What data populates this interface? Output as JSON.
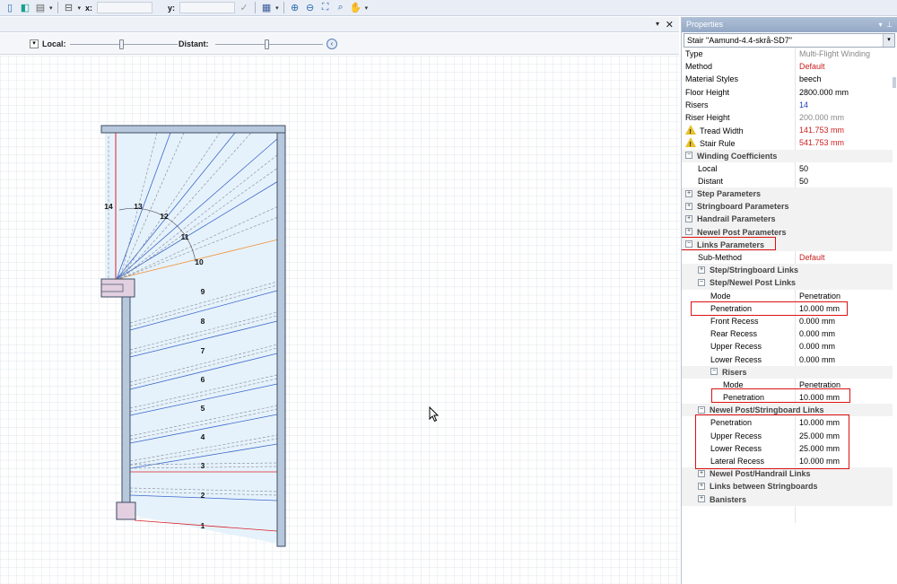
{
  "toolbar": {
    "x_label": "x:",
    "y_label": "y:",
    "icons": [
      "pipe-icon",
      "cube-icon",
      "layers-icon",
      "list-dropdown-icon",
      "stair-icon",
      "dropdown-icon",
      "check-icon",
      "grid-icon",
      "dropdown-icon",
      "zoom-in-icon",
      "zoom-out-icon",
      "zoom-extents-icon",
      "zoom-window-icon",
      "pan-hand-icon",
      "dropdown-icon"
    ]
  },
  "doc_header": {
    "close_glyph": "✕",
    "drop_glyph": "▾"
  },
  "slider_bar": {
    "local_label": "Local:",
    "distant_label": "Distant:"
  },
  "canvas": {
    "step_numbers": [
      "1",
      "2",
      "3",
      "4",
      "5",
      "6",
      "7",
      "8",
      "9",
      "10",
      "11",
      "12",
      "13",
      "14"
    ]
  },
  "properties": {
    "title": "Properties",
    "object_name": "Stair \"Aamund-4.4-skrå-SD7\"",
    "rows": [
      {
        "key": "Type",
        "value": "Multi-Flight Winding",
        "value_style": "grey"
      },
      {
        "key": "Method",
        "value": "Default",
        "value_style": "red"
      },
      {
        "key": "Material Styles",
        "value": "beech"
      },
      {
        "key": "Floor Height",
        "value": "2800.000 mm"
      },
      {
        "key": "Risers",
        "value": "14",
        "value_style": "blue"
      },
      {
        "key": "Riser Height",
        "value": "200.000 mm",
        "value_style": "grey"
      },
      {
        "key": "Tread Width",
        "value": "141.753 mm",
        "value_style": "red",
        "warn": true
      },
      {
        "key": "Stair Rule",
        "value": "541.753 mm",
        "value_style": "red",
        "warn": true
      },
      {
        "key": "Winding Coefficients",
        "category": true,
        "expanded": true,
        "indent": 0
      },
      {
        "key": "Local",
        "value": "50",
        "indent": 1
      },
      {
        "key": "Distant",
        "value": "50",
        "indent": 1
      },
      {
        "key": "Step Parameters",
        "category": true,
        "expanded": false,
        "indent": 0
      },
      {
        "key": "Stringboard Parameters",
        "category": true,
        "expanded": false,
        "indent": 0
      },
      {
        "key": "Handrail Parameters",
        "category": true,
        "expanded": false,
        "indent": 0
      },
      {
        "key": "Newel Post Parameters",
        "category": true,
        "expanded": false,
        "indent": 0
      },
      {
        "key": "Links Parameters",
        "category": true,
        "expanded": true,
        "indent": 0
      },
      {
        "key": "Sub-Method",
        "value": "Default",
        "value_style": "red",
        "indent": 1
      },
      {
        "key": "Step/Stringboard Links",
        "category": true,
        "expanded": false,
        "indent": 1
      },
      {
        "key": "Step/Newel Post Links",
        "category": true,
        "expanded": true,
        "indent": 1
      },
      {
        "key": "Mode",
        "value": "Penetration",
        "indent": 2
      },
      {
        "key": "Penetration",
        "value": "10.000 mm",
        "indent": 2
      },
      {
        "key": "Front Recess",
        "value": "0.000 mm",
        "indent": 2
      },
      {
        "key": "Rear Recess",
        "value": "0.000 mm",
        "indent": 2
      },
      {
        "key": "Upper Recess",
        "value": "0.000 mm",
        "indent": 2
      },
      {
        "key": "Lower Recess",
        "value": "0.000 mm",
        "indent": 2
      },
      {
        "key": "Risers",
        "category": true,
        "expanded": true,
        "indent": 2
      },
      {
        "key": "Mode",
        "value": "Penetration",
        "indent": 3
      },
      {
        "key": "Penetration",
        "value": "10.000 mm",
        "indent": 3
      },
      {
        "key": "Newel Post/Stringboard Links",
        "category": true,
        "expanded": true,
        "indent": 1
      },
      {
        "key": "Penetration",
        "value": "10.000 mm",
        "indent": 2
      },
      {
        "key": "Upper Recess",
        "value": "25.000 mm",
        "indent": 2
      },
      {
        "key": "Lower Recess",
        "value": "25.000 mm",
        "indent": 2
      },
      {
        "key": "Lateral Recess",
        "value": "10.000 mm",
        "indent": 2
      },
      {
        "key": "Newel Post/Handrail Links",
        "category": true,
        "expanded": false,
        "indent": 1
      },
      {
        "key": "Links between Stringboards",
        "category": true,
        "expanded": false,
        "indent": 1
      },
      {
        "key": "Banisters",
        "category": true,
        "expanded": false,
        "indent": 1
      }
    ]
  },
  "colors": {
    "stair_fill": "#e6f2fb",
    "blue_line": "#3a66cc",
    "red_line": "#d8202a",
    "orange_line": "#f0913a",
    "stringer": "#b7c8dc",
    "newel": "#e2cfe0",
    "grid": "#d8dde6",
    "highlight": "#dd1111"
  }
}
